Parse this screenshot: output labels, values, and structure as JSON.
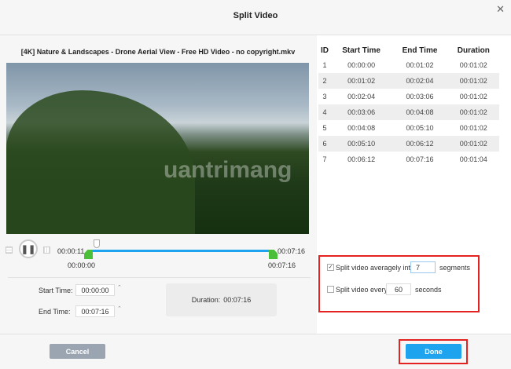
{
  "dialog": {
    "title": "Split Video",
    "close": "✕"
  },
  "file": {
    "name": "[4K] Nature & Landscapes - Drone Aerial View - Free HD Video - no copyright.mkv"
  },
  "watermark": "uantrimang",
  "player": {
    "current_time": "00:00:11",
    "end_time_top": "00:07:16",
    "range_start": "00:00:00",
    "range_end": "00:07:16",
    "progress": 0.025
  },
  "trim": {
    "start_label": "Start Time:",
    "start_value": "00:00:00",
    "end_label": "End Time:",
    "end_value": "00:07:16",
    "duration_label": "Duration:",
    "duration_value": "00:07:16"
  },
  "table": {
    "headers": [
      "ID",
      "Start Time",
      "End Time",
      "Duration"
    ],
    "rows": [
      [
        "1",
        "00:00:00",
        "00:01:02",
        "00:01:02"
      ],
      [
        "2",
        "00:01:02",
        "00:02:04",
        "00:01:02"
      ],
      [
        "3",
        "00:02:04",
        "00:03:06",
        "00:01:02"
      ],
      [
        "4",
        "00:03:06",
        "00:04:08",
        "00:01:02"
      ],
      [
        "5",
        "00:04:08",
        "00:05:10",
        "00:01:02"
      ],
      [
        "6",
        "00:05:10",
        "00:06:12",
        "00:01:02"
      ],
      [
        "7",
        "00:06:12",
        "00:07:16",
        "00:01:04"
      ]
    ]
  },
  "split": {
    "avg_label": "Split video averagely into",
    "avg_value": "7",
    "avg_unit": "segments",
    "avg_checked": true,
    "every_label": "Split video every",
    "every_value": "60",
    "every_unit": "seconds",
    "every_checked": false
  },
  "buttons": {
    "cancel": "Cancel",
    "done": "Done"
  },
  "colors": {
    "accent": "#1ea4ee",
    "highlight": "#e52222",
    "handle": "#4cbf3a"
  }
}
